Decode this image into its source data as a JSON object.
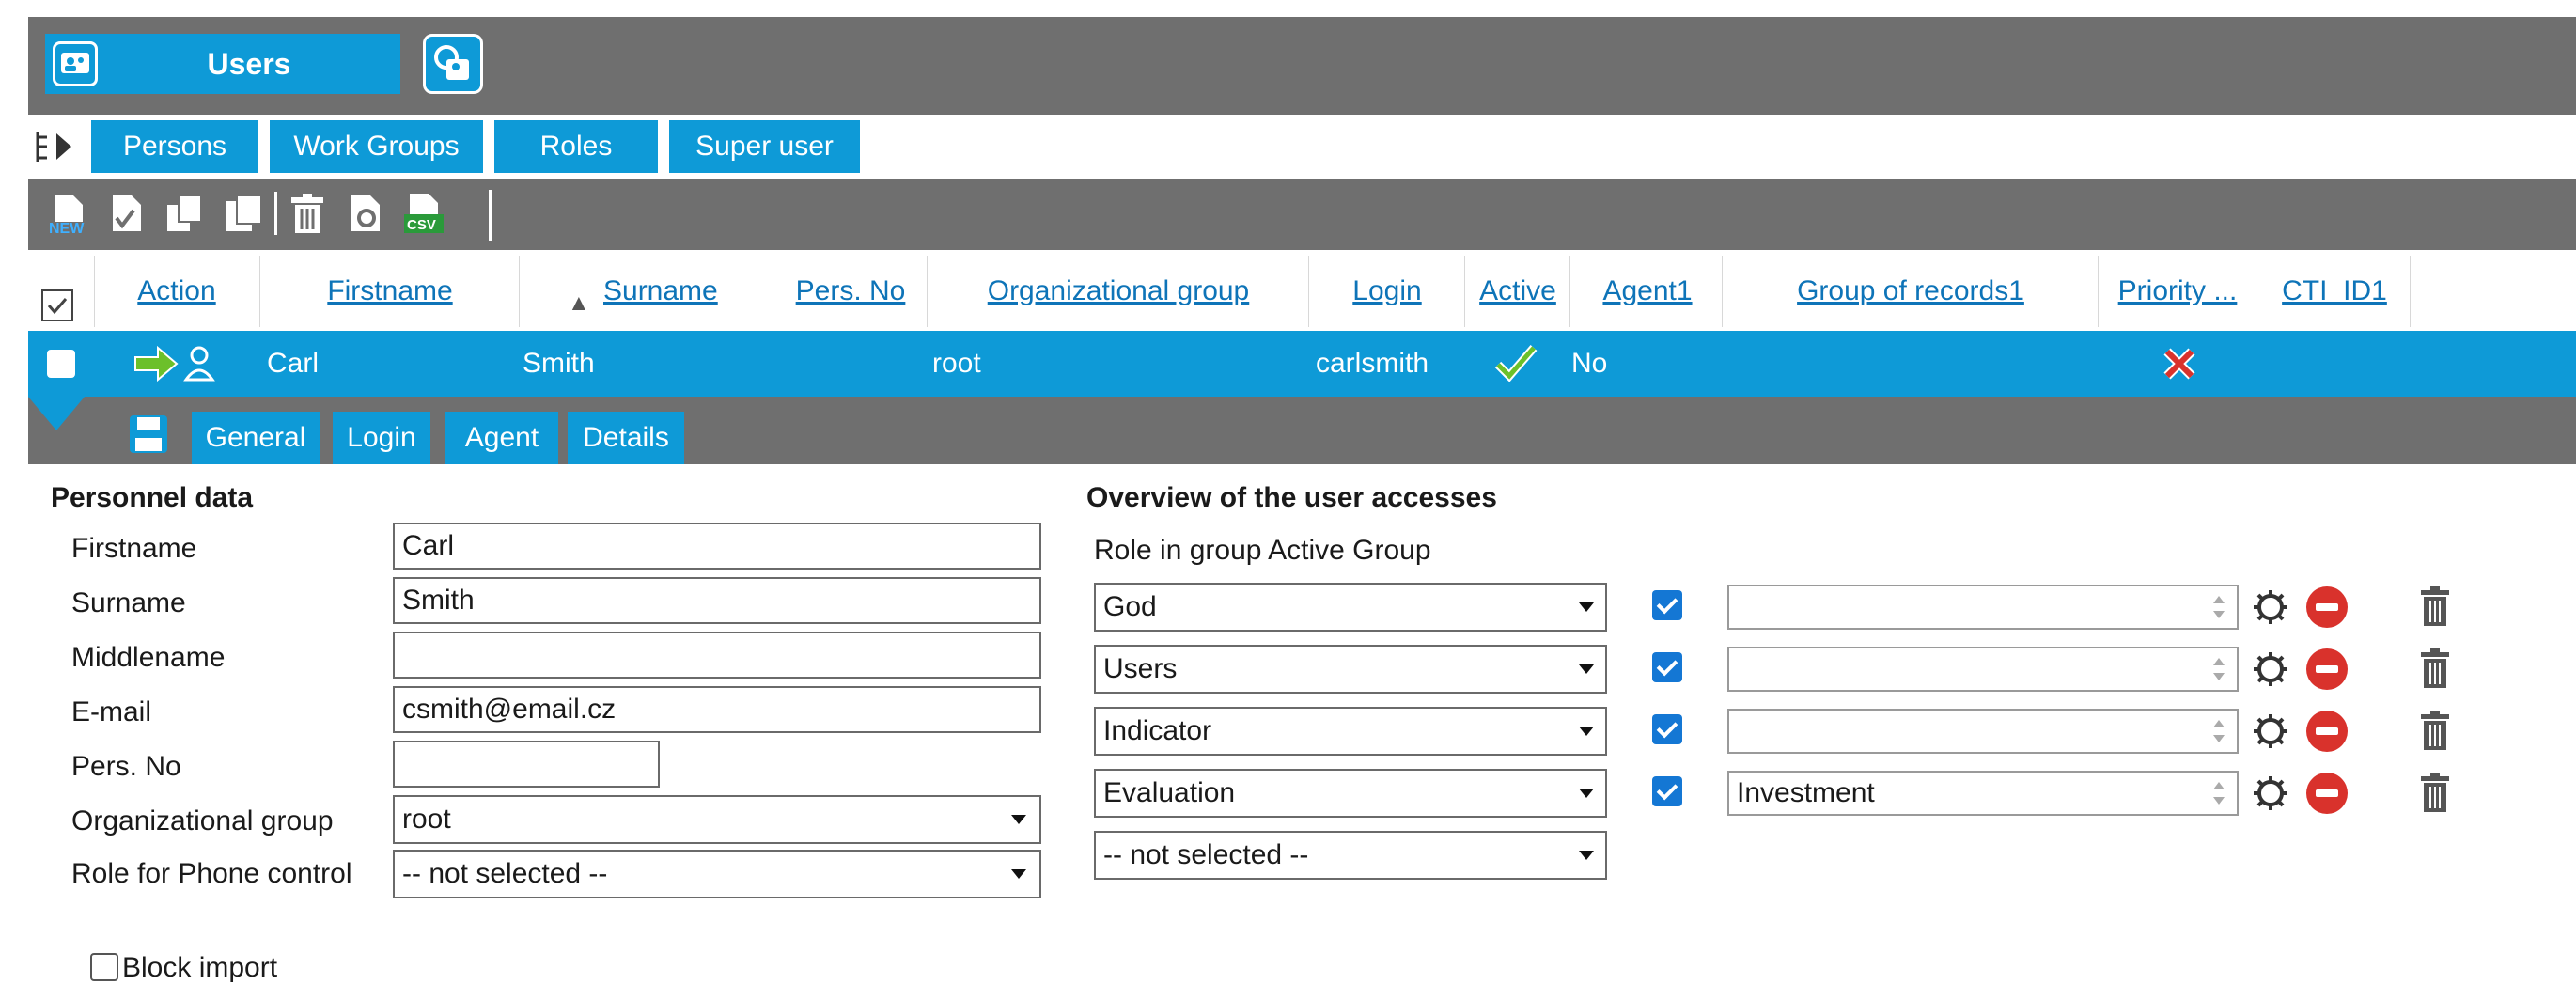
{
  "window": {
    "title": "Users"
  },
  "top_tabs": [
    {
      "label": "Persons"
    },
    {
      "label": "Work Groups"
    },
    {
      "label": "Roles"
    },
    {
      "label": "Super user"
    }
  ],
  "toolbar": {
    "icons": [
      "new-icon",
      "edit-icon",
      "copy-icon",
      "archive-icon",
      "delete-icon",
      "settings-doc-icon",
      "csv-export-icon"
    ]
  },
  "table": {
    "columns": [
      "Action",
      "Firstname",
      "Surname",
      "Pers. No",
      "Organizational group",
      "Login",
      "Active",
      "Agent1",
      "Group of records1",
      "Priority ...",
      "CTI_ID1"
    ],
    "sort_indicator": "▲",
    "rows": [
      {
        "firstname": "Carl",
        "surname": "Smith",
        "pers_no": "",
        "org_group": "root",
        "login": "carlsmith",
        "active": true,
        "agent1": "No",
        "group_of_records1": "",
        "priority": "x",
        "cti_id1": ""
      }
    ]
  },
  "detail_tabs": [
    {
      "label": "General"
    },
    {
      "label": "Login"
    },
    {
      "label": "Agent"
    },
    {
      "label": "Details"
    }
  ],
  "personnel": {
    "section_title": "Personnel data",
    "fields": [
      {
        "label": "Firstname",
        "value": "Carl"
      },
      {
        "label": "Surname",
        "value": "Smith"
      },
      {
        "label": "Middlename",
        "value": ""
      },
      {
        "label": "E-mail",
        "value": "csmith@email.cz"
      },
      {
        "label": "Pers. No",
        "value": ""
      },
      {
        "label": "Organizational group",
        "value": "root"
      },
      {
        "label": "Role for Phone control",
        "value": "-- not selected --"
      }
    ],
    "block_import": {
      "label": "Block import",
      "checked": false
    }
  },
  "accesses": {
    "section_title": "Overview of the user accesses",
    "header": "Role in group Active Group",
    "rows": [
      {
        "role": "God",
        "active": true,
        "group": ""
      },
      {
        "role": "Users",
        "active": true,
        "group": ""
      },
      {
        "role": "Indicator",
        "active": true,
        "group": ""
      },
      {
        "role": "Evaluation",
        "active": true,
        "group": "Investment"
      }
    ],
    "new_role_placeholder": "-- not selected --"
  },
  "colors": {
    "accent": "#0e9ad7",
    "bar": "#6f6f6f",
    "link": "#0e74b8",
    "danger": "#d9322c",
    "ok": "#6cc02a"
  }
}
